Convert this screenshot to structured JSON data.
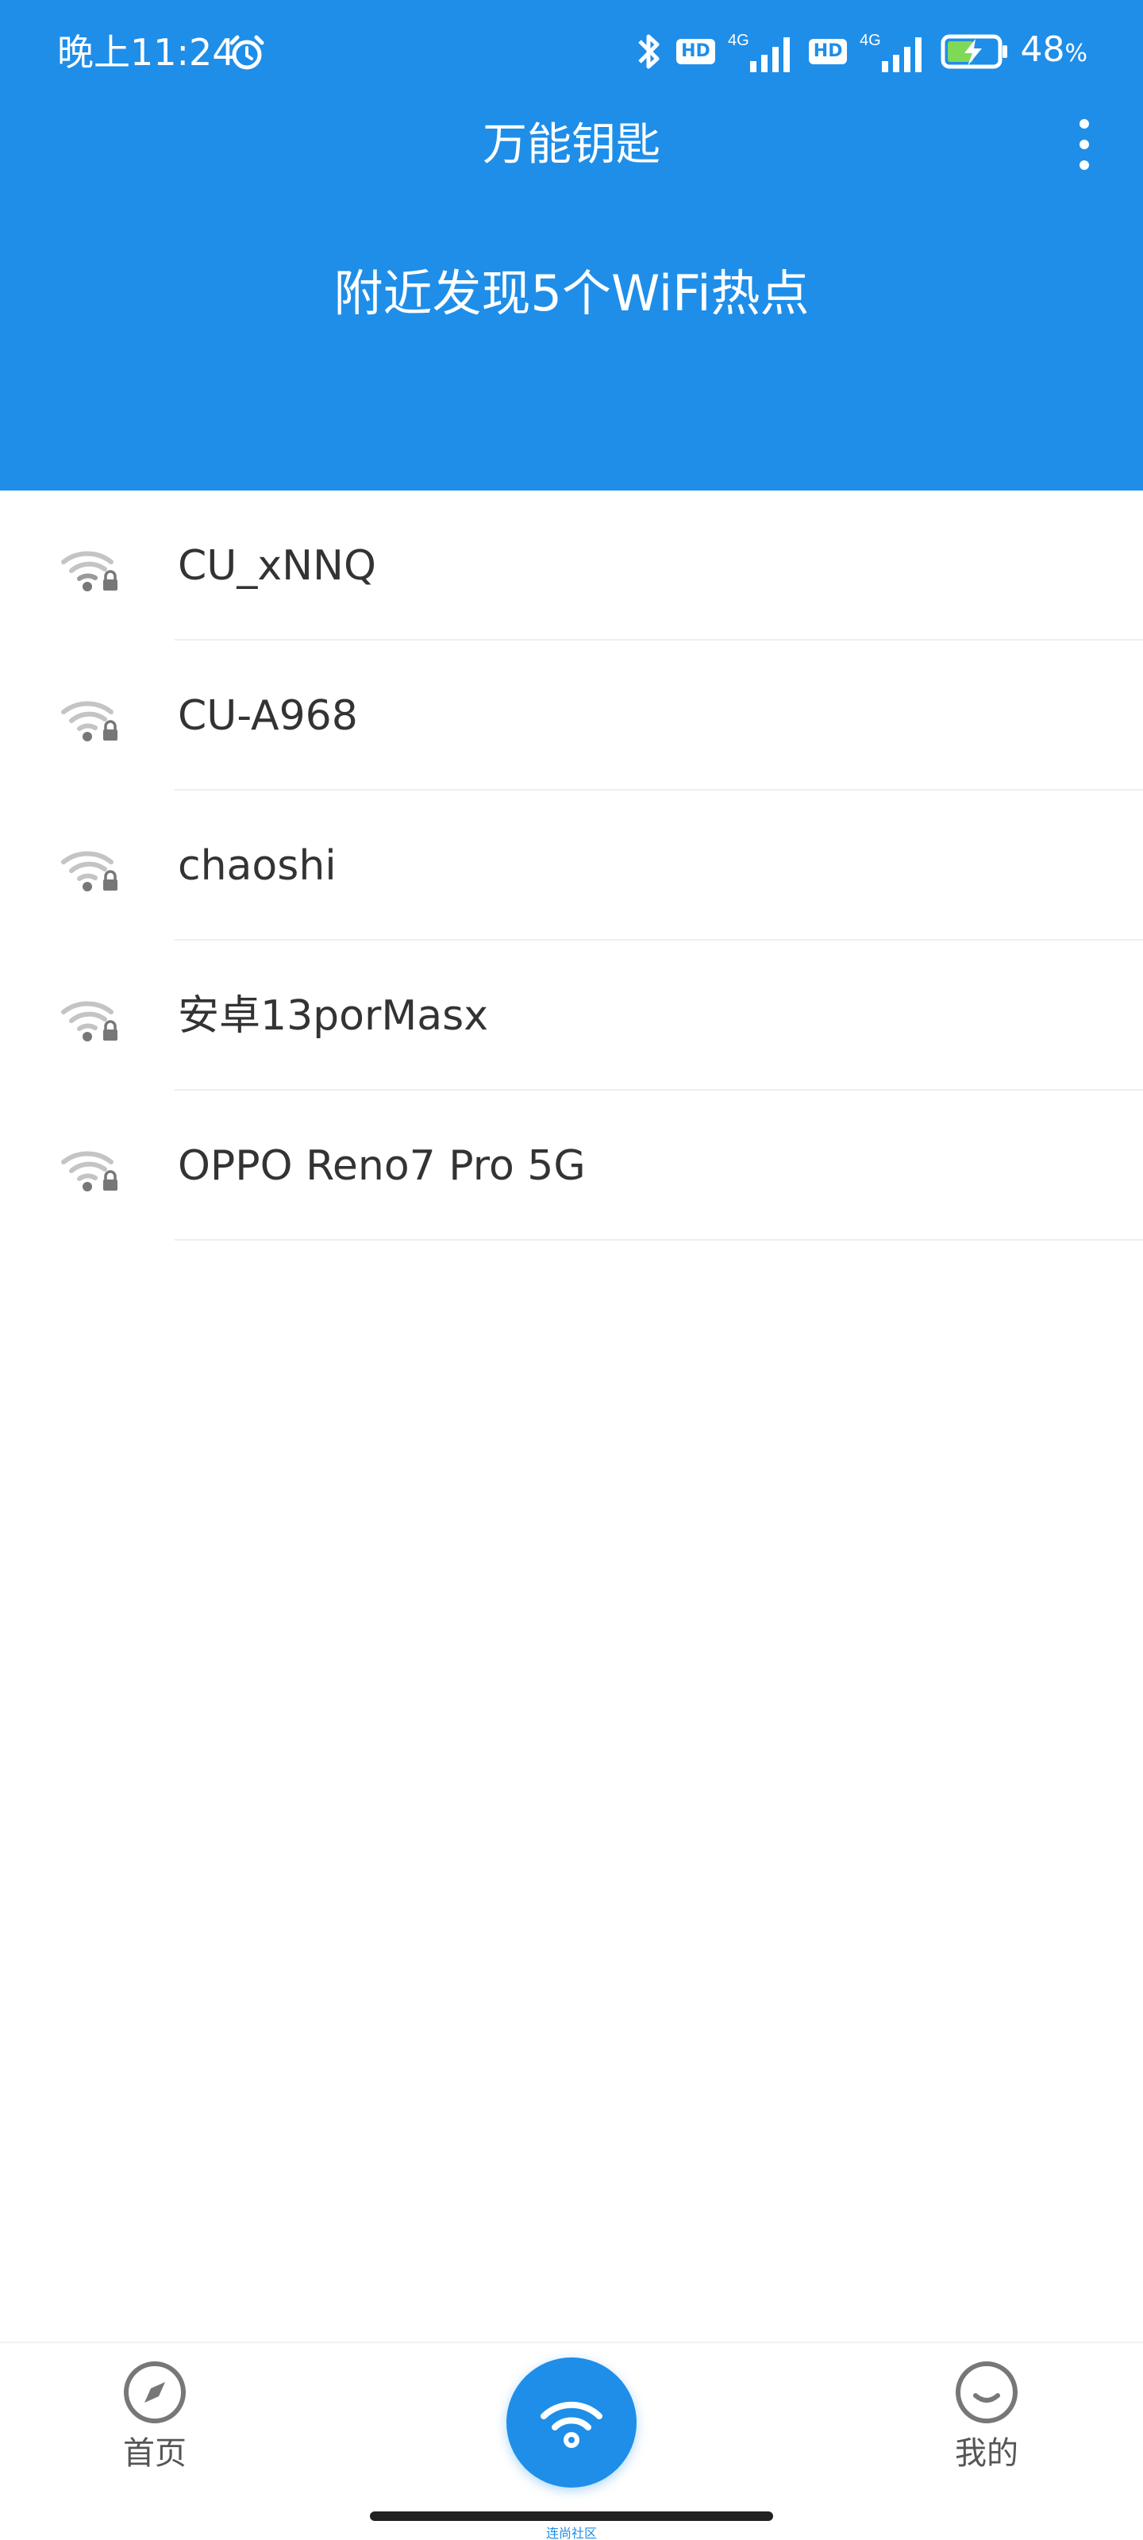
{
  "status_bar": {
    "time": "晚上11:24",
    "hd_label": "HD",
    "network_type": "4G",
    "battery_percent_value": "48",
    "battery_percent_sign": "%"
  },
  "header": {
    "title": "万能钥匙",
    "summary": "附近发现5个WiFi热点"
  },
  "networks": [
    {
      "ssid": "CU_xNNQ",
      "locked": true
    },
    {
      "ssid": "CU-A968",
      "locked": true
    },
    {
      "ssid": "chaoshi",
      "locked": true
    },
    {
      "ssid": "安卓13porMasx",
      "locked": true
    },
    {
      "ssid": "OPPO Reno7 Pro 5G",
      "locked": true
    }
  ],
  "bottom_nav": {
    "home_label": "首页",
    "mine_label": "我的",
    "center_caption": "连尚社区"
  },
  "colors": {
    "primary": "#1e8ee9",
    "text": "#333333",
    "icon_gray": "#b5b5b5"
  }
}
